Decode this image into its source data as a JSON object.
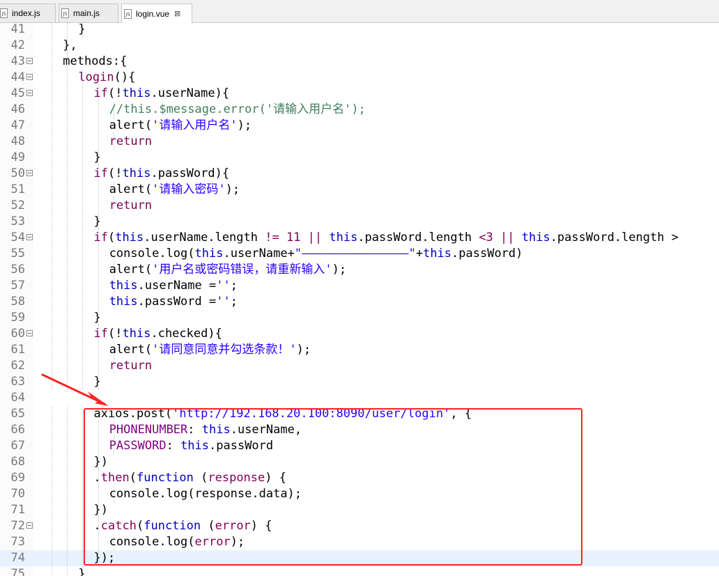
{
  "tabs": [
    {
      "name": "index.js",
      "icon": "js-file-icon",
      "active": false
    },
    {
      "name": "main.js",
      "icon": "js-file-icon",
      "active": false
    },
    {
      "name": "login.vue",
      "icon": "vue-file-icon",
      "active": true,
      "close": "⊠"
    }
  ],
  "icon_label": "JS",
  "current_line": 74,
  "lines": [
    {
      "n": "41",
      "fold": false,
      "indent": 5,
      "tokens": [
        {
          "t": "}",
          "c": ""
        }
      ]
    },
    {
      "n": "42",
      "fold": false,
      "indent": 4,
      "tokens": [
        {
          "t": "},",
          "c": ""
        }
      ]
    },
    {
      "n": "43",
      "fold": true,
      "indent": 4,
      "tokens": [
        {
          "t": "methods:{",
          "c": ""
        }
      ]
    },
    {
      "n": "44",
      "fold": true,
      "indent": 5,
      "tokens": [
        {
          "t": "login",
          "c": "k"
        },
        {
          "t": "(){",
          "c": ""
        }
      ]
    },
    {
      "n": "45",
      "fold": true,
      "indent": 6,
      "tokens": [
        {
          "t": "if",
          "c": "k"
        },
        {
          "t": "(!",
          "c": ""
        },
        {
          "t": "this",
          "c": "th"
        },
        {
          "t": ".userName){",
          "c": ""
        }
      ]
    },
    {
      "n": "46",
      "fold": false,
      "indent": 7,
      "tokens": [
        {
          "t": "//this.$message.error('请输入用户名');",
          "c": "c"
        }
      ]
    },
    {
      "n": "47",
      "fold": false,
      "indent": 7,
      "tokens": [
        {
          "t": "alert(",
          "c": ""
        },
        {
          "t": "'请输入用户名'",
          "c": "s"
        },
        {
          "t": ");",
          "c": ""
        }
      ]
    },
    {
      "n": "48",
      "fold": false,
      "indent": 7,
      "tokens": [
        {
          "t": "return",
          "c": "k"
        }
      ]
    },
    {
      "n": "49",
      "fold": false,
      "indent": 6,
      "tokens": [
        {
          "t": "}",
          "c": ""
        }
      ]
    },
    {
      "n": "50",
      "fold": true,
      "indent": 6,
      "tokens": [
        {
          "t": "if",
          "c": "k"
        },
        {
          "t": "(!",
          "c": ""
        },
        {
          "t": "this",
          "c": "th"
        },
        {
          "t": ".passWord){",
          "c": ""
        }
      ]
    },
    {
      "n": "51",
      "fold": false,
      "indent": 7,
      "tokens": [
        {
          "t": "alert(",
          "c": ""
        },
        {
          "t": "'请输入密码'",
          "c": "s"
        },
        {
          "t": ");",
          "c": ""
        }
      ]
    },
    {
      "n": "52",
      "fold": false,
      "indent": 7,
      "tokens": [
        {
          "t": "return",
          "c": "k"
        }
      ]
    },
    {
      "n": "53",
      "fold": false,
      "indent": 6,
      "tokens": [
        {
          "t": "}",
          "c": ""
        }
      ]
    },
    {
      "n": "54",
      "fold": true,
      "indent": 6,
      "tokens": [
        {
          "t": "if",
          "c": "k"
        },
        {
          "t": "(",
          "c": ""
        },
        {
          "t": "this",
          "c": "th"
        },
        {
          "t": ".userName.length ",
          "c": ""
        },
        {
          "t": "!= 11 || ",
          "c": "lit"
        },
        {
          "t": "this",
          "c": "th"
        },
        {
          "t": ".passWord.length ",
          "c": ""
        },
        {
          "t": "<3 || ",
          "c": "lit"
        },
        {
          "t": "this",
          "c": "th"
        },
        {
          "t": ".passWord.length >",
          "c": ""
        }
      ]
    },
    {
      "n": "55",
      "fold": false,
      "indent": 7,
      "tokens": [
        {
          "t": "console.log(",
          "c": ""
        },
        {
          "t": "this",
          "c": "th"
        },
        {
          "t": ".userName+",
          "c": ""
        },
        {
          "t": "\"———————————————\"",
          "c": "s"
        },
        {
          "t": "+",
          "c": ""
        },
        {
          "t": "this",
          "c": "th"
        },
        {
          "t": ".passWord)",
          "c": ""
        }
      ]
    },
    {
      "n": "56",
      "fold": false,
      "indent": 7,
      "tokens": [
        {
          "t": "alert(",
          "c": ""
        },
        {
          "t": "'用户名或密码错误，请重新输入'",
          "c": "s"
        },
        {
          "t": ");",
          "c": ""
        }
      ]
    },
    {
      "n": "57",
      "fold": false,
      "indent": 7,
      "tokens": [
        {
          "t": "this",
          "c": "th"
        },
        {
          "t": ".userName =",
          "c": ""
        },
        {
          "t": "''",
          "c": "s"
        },
        {
          "t": ";",
          "c": ""
        }
      ]
    },
    {
      "n": "58",
      "fold": false,
      "indent": 7,
      "tokens": [
        {
          "t": "this",
          "c": "th"
        },
        {
          "t": ".passWord =",
          "c": ""
        },
        {
          "t": "''",
          "c": "s"
        },
        {
          "t": ";",
          "c": ""
        }
      ]
    },
    {
      "n": "59",
      "fold": false,
      "indent": 6,
      "tokens": [
        {
          "t": "}",
          "c": ""
        }
      ]
    },
    {
      "n": "60",
      "fold": true,
      "indent": 6,
      "tokens": [
        {
          "t": "if",
          "c": "k"
        },
        {
          "t": "(!",
          "c": ""
        },
        {
          "t": "this",
          "c": "th"
        },
        {
          "t": ".checked){",
          "c": ""
        }
      ]
    },
    {
      "n": "61",
      "fold": false,
      "indent": 7,
      "tokens": [
        {
          "t": "alert(",
          "c": ""
        },
        {
          "t": "'请同意同意并勾选条款！'",
          "c": "s"
        },
        {
          "t": ");",
          "c": ""
        }
      ]
    },
    {
      "n": "62",
      "fold": false,
      "indent": 7,
      "tokens": [
        {
          "t": "return",
          "c": "k"
        }
      ]
    },
    {
      "n": "63",
      "fold": false,
      "indent": 6,
      "tokens": [
        {
          "t": "}",
          "c": ""
        }
      ]
    },
    {
      "n": "64",
      "fold": false,
      "indent": 0,
      "tokens": []
    },
    {
      "n": "65",
      "fold": false,
      "indent": 6,
      "tokens": [
        {
          "t": "axios.post(",
          "c": ""
        },
        {
          "t": "'http://192.168.20.100:8090/user/login'",
          "c": "s"
        },
        {
          "t": ", {",
          "c": ""
        }
      ]
    },
    {
      "n": "66",
      "fold": false,
      "indent": 7,
      "tokens": [
        {
          "t": "PHONENUMBER",
          "c": "prop"
        },
        {
          "t": ": ",
          "c": ""
        },
        {
          "t": "this",
          "c": "th"
        },
        {
          "t": ".userName,",
          "c": ""
        }
      ]
    },
    {
      "n": "67",
      "fold": false,
      "indent": 7,
      "tokens": [
        {
          "t": "PASSWORD",
          "c": "prop"
        },
        {
          "t": ": ",
          "c": ""
        },
        {
          "t": "this",
          "c": "th"
        },
        {
          "t": ".passWord",
          "c": ""
        }
      ]
    },
    {
      "n": "68",
      "fold": false,
      "indent": 6,
      "tokens": [
        {
          "t": "})",
          "c": ""
        }
      ]
    },
    {
      "n": "69",
      "fold": false,
      "indent": 6,
      "tokens": [
        {
          "t": ".",
          "c": ""
        },
        {
          "t": "then",
          "c": "k"
        },
        {
          "t": "(",
          "c": ""
        },
        {
          "t": "function",
          "c": "th"
        },
        {
          "t": " (",
          "c": ""
        },
        {
          "t": "response",
          "c": "k"
        },
        {
          "t": ") {",
          "c": ""
        }
      ]
    },
    {
      "n": "70",
      "fold": false,
      "indent": 7,
      "tokens": [
        {
          "t": "console.log(response.data);",
          "c": ""
        }
      ]
    },
    {
      "n": "71",
      "fold": false,
      "indent": 6,
      "tokens": [
        {
          "t": "})",
          "c": ""
        }
      ]
    },
    {
      "n": "72",
      "fold": true,
      "indent": 6,
      "tokens": [
        {
          "t": ".",
          "c": ""
        },
        {
          "t": "catch",
          "c": "k"
        },
        {
          "t": "(",
          "c": ""
        },
        {
          "t": "function",
          "c": "th"
        },
        {
          "t": " (",
          "c": ""
        },
        {
          "t": "error",
          "c": "k"
        },
        {
          "t": ") {",
          "c": ""
        }
      ]
    },
    {
      "n": "73",
      "fold": false,
      "indent": 7,
      "tokens": [
        {
          "t": "console.log(",
          "c": ""
        },
        {
          "t": "error",
          "c": "k"
        },
        {
          "t": ");",
          "c": ""
        }
      ]
    },
    {
      "n": "74",
      "fold": false,
      "indent": 6,
      "tokens": [
        {
          "t": "});",
          "c": ""
        }
      ]
    },
    {
      "n": "75",
      "fold": false,
      "indent": 5,
      "tokens": [
        {
          "t": "}",
          "c": ""
        }
      ]
    }
  ],
  "colors": {
    "keyword": "#7f0055",
    "this": "#0000c0",
    "string": "#2a00ff",
    "comment": "#3f7f5f",
    "property": "#7f007f",
    "annotation_red": "#ff2222",
    "current_line_bg": "#e8f2fe"
  }
}
